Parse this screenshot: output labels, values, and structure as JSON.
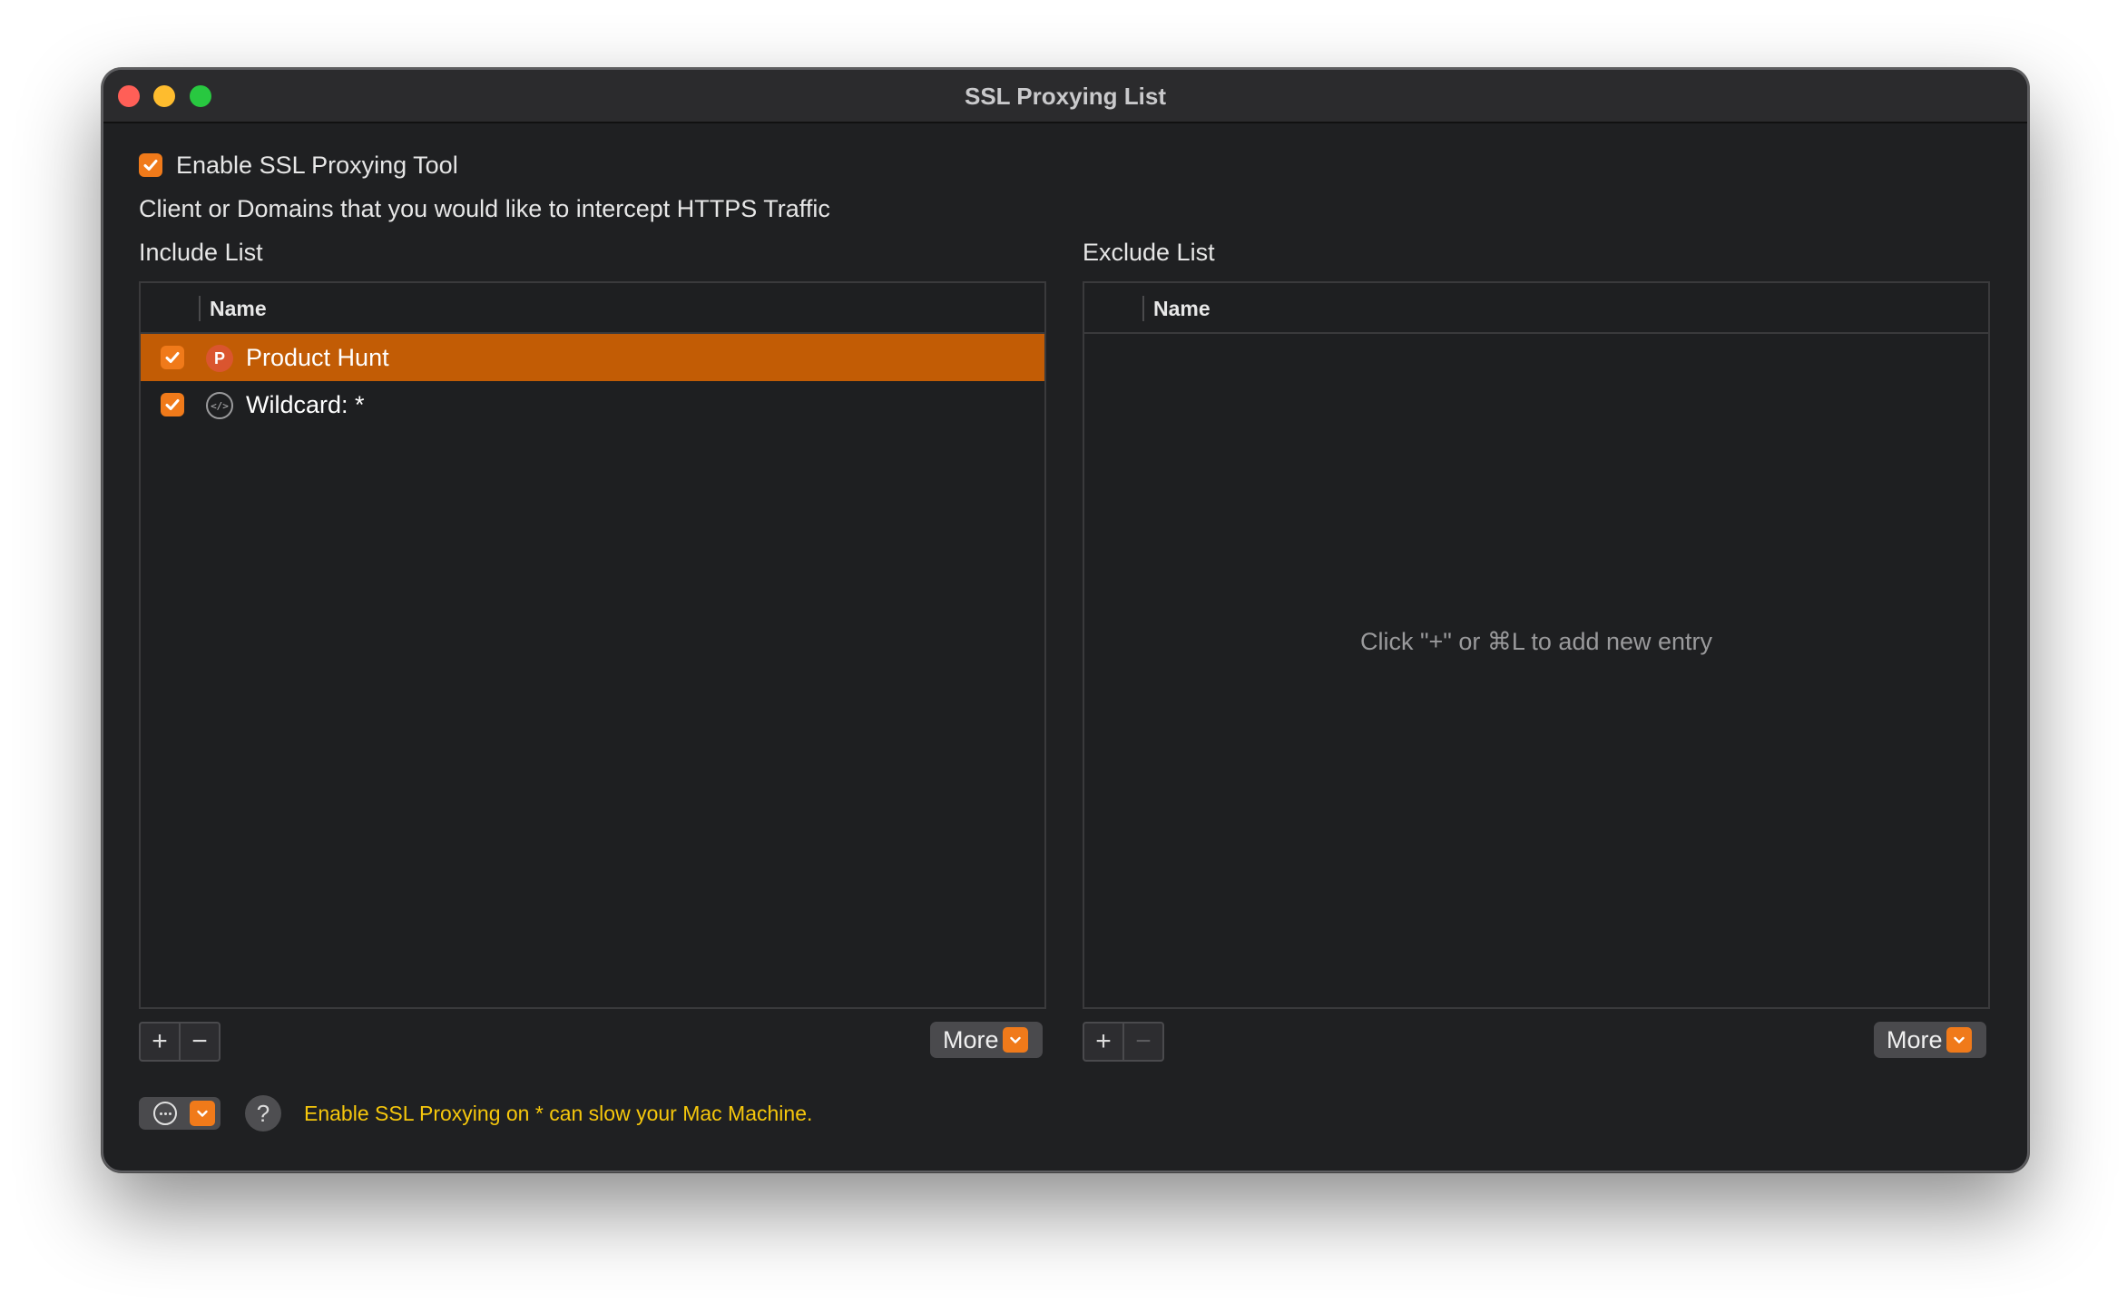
{
  "window": {
    "title": "SSL Proxying List"
  },
  "enable": {
    "label": "Enable SSL Proxying Tool",
    "checked": true
  },
  "description": "Client or Domains that you would like to intercept HTTPS Traffic",
  "include": {
    "title": "Include List",
    "column": "Name",
    "items": [
      {
        "label": "Product Hunt",
        "checked": true,
        "selected": true,
        "icon": "product-hunt-icon",
        "icon_text": "P"
      },
      {
        "label": "Wildcard: *",
        "checked": true,
        "selected": false,
        "icon": "code-icon",
        "icon_text": "</>"
      }
    ],
    "add": "+",
    "remove": "−",
    "more": "More"
  },
  "exclude": {
    "title": "Exclude List",
    "column": "Name",
    "empty": "Click \"+\" or ⌘L to add new entry",
    "add": "+",
    "remove": "−",
    "more": "More"
  },
  "footer": {
    "help": "?",
    "warning": "Enable SSL Proxying on * can slow your Mac Machine."
  },
  "colors": {
    "accent": "#f07a1a",
    "selection": "#c25c05",
    "warning": "#f6c70c",
    "background": "#1f2022"
  }
}
